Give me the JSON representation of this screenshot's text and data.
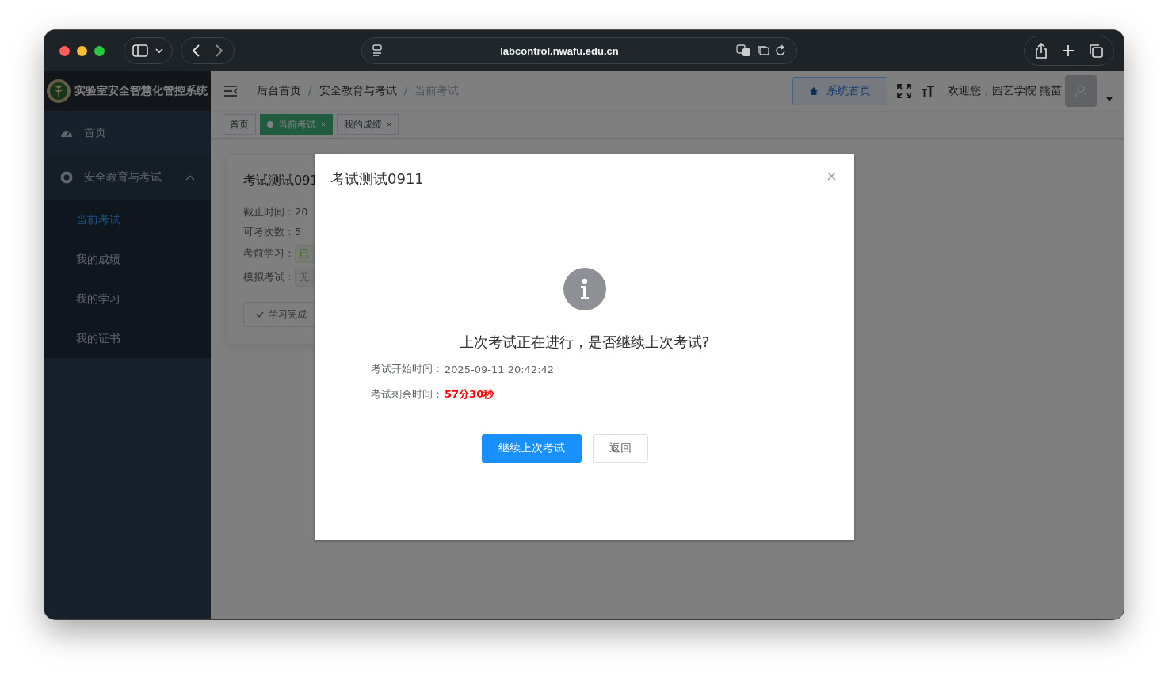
{
  "browser": {
    "url": "labcontrol.nwafu.edu.cn"
  },
  "sidebar": {
    "title": "实验室安全智慧化管控系统",
    "items": [
      {
        "label": "首页",
        "kind": "link"
      },
      {
        "label": "安全教育与考试",
        "kind": "group",
        "expanded": true,
        "children": [
          {
            "label": "当前考试",
            "selected": true
          },
          {
            "label": "我的成绩",
            "selected": false
          },
          {
            "label": "我的学习",
            "selected": false
          },
          {
            "label": "我的证书",
            "selected": false
          }
        ]
      }
    ]
  },
  "header": {
    "separators": [
      "/",
      "/"
    ],
    "breadcrumb": [
      {
        "label": "后台首页",
        "current": false
      },
      {
        "label": "安全教育与考试",
        "current": false
      },
      {
        "label": "当前考试",
        "current": true
      }
    ],
    "home_button": "系统首页",
    "welcome": "欢迎您，园艺学院 熊苗"
  },
  "tabs": [
    {
      "label": "首页",
      "selected": false,
      "closable": false
    },
    {
      "label": "当前考试",
      "selected": true,
      "closable": true
    },
    {
      "label": "我的成绩",
      "selected": false,
      "closable": true
    }
  ],
  "card": {
    "title": "考试测试091",
    "fields": [
      {
        "label": "截止时间：",
        "value": "20",
        "kind": "text"
      },
      {
        "label": "可考次数：",
        "value": "5",
        "kind": "text"
      },
      {
        "label": "考前学习：",
        "value": "已",
        "kind": "tag-success"
      },
      {
        "label": "模拟考试：",
        "value": "无",
        "kind": "tag"
      }
    ],
    "button": "学习完成"
  },
  "dialog": {
    "title": "考试测试0911",
    "message": "上次考试正在进行，是否继续上次考试?",
    "rows": [
      {
        "label": "考试开始时间：",
        "value": "2025-09-11 20:42:42",
        "kind": "plain"
      },
      {
        "label": "考试剩余时间：",
        "value": "57分30秒",
        "kind": "alert"
      }
    ],
    "buttons": [
      {
        "label": "继续上次考试",
        "kind": "primary"
      },
      {
        "label": "返回",
        "kind": "default"
      }
    ]
  }
}
